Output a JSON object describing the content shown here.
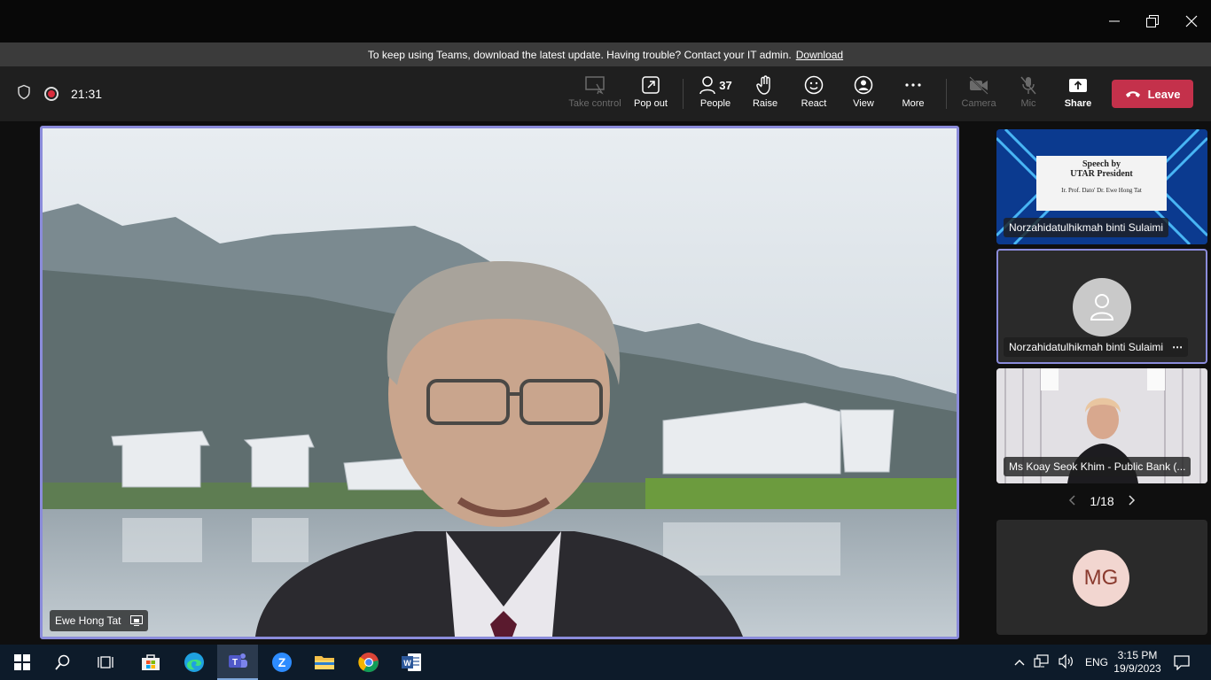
{
  "window": {
    "controls": [
      "minimize-icon",
      "restore-icon",
      "close-icon"
    ]
  },
  "banner": {
    "message": "To keep using Teams, download the latest update. Having trouble? Contact your IT admin.",
    "link": "Download"
  },
  "meeting": {
    "timer": "21:31"
  },
  "toolbar": {
    "take_control": "Take control",
    "pop_out": "Pop out",
    "people_count": "37",
    "people": "People",
    "raise": "Raise",
    "react": "React",
    "view": "View",
    "more": "More",
    "camera": "Camera",
    "mic": "Mic",
    "share": "Share",
    "leave": "Leave"
  },
  "main_video": {
    "participant": "Ewe Hong Tat"
  },
  "side_tiles": [
    {
      "name": "Norzahidatulhikmah binti Sulaimi",
      "slide_title": "Speech by",
      "slide_subtitle": "UTAR President",
      "slide_name": "Ir. Prof. Dato' Dr. Ewe Hong Tat"
    },
    {
      "name": "Norzahidatulhikmah binti Sulaimi",
      "more": "⋯"
    },
    {
      "name": "Ms Koay Seok Khim - Public Bank (..."
    },
    {
      "initials": "MG"
    }
  ],
  "pager": {
    "text": "1/18"
  },
  "taskbar": {
    "time": "3:15 PM",
    "date": "19/9/2023",
    "lang": "ENG"
  },
  "colors": {
    "accent": "#8b8cdb",
    "leave": "#c4314b",
    "avatar_mg": "#f2d6d0",
    "avatar_mg_text": "#8a3a2e"
  }
}
